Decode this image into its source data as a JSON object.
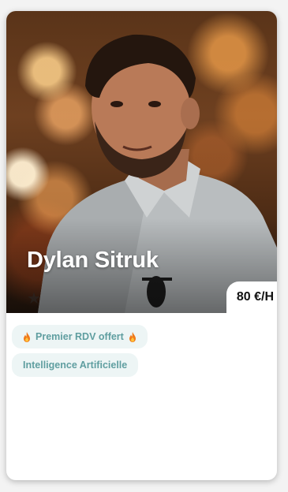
{
  "profile": {
    "name": "Dylan Sitruk",
    "price": "80 €/H",
    "rating_icon": "star-icon"
  },
  "tags": [
    {
      "label": "Premier RDV offert",
      "icon": "fire-icon"
    },
    {
      "label": "Intelligence Artificielle"
    }
  ],
  "colors": {
    "tag_bg": "#edf5f5",
    "tag_text": "#5f9ea0",
    "card_bg": "#ffffff"
  }
}
